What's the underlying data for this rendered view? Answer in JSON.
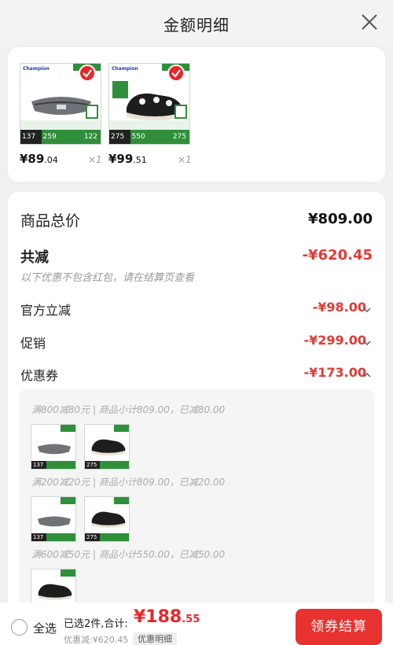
{
  "header": {
    "title": "金额明细",
    "close_icon": "close-icon"
  },
  "products": [
    {
      "price_int": "¥89",
      "price_dec": ".04",
      "qty": "×1",
      "badge": "137",
      "n1": "259",
      "n2": "122"
    },
    {
      "price_int": "¥99",
      "price_dec": ".51",
      "qty": "×1",
      "badge": "275",
      "n1": "550",
      "n2": "275"
    }
  ],
  "thumb_brand": "Champion",
  "summary": {
    "total_label": "商品总价",
    "total_value": "¥809.00",
    "discount_label": "共减",
    "discount_value": "-¥620.45",
    "note": "以下优惠不包含红包，请在结算页查看",
    "official_label": "官方立减",
    "official_value": "-¥98.00",
    "promo_label": "促销",
    "promo_value": "-¥299.00",
    "coupon_label": "优惠券",
    "coupon_value": "-¥173.00"
  },
  "coupons": [
    {
      "text": "满800减80元 | 商品小计809.00，已减80.00"
    },
    {
      "text": "满200减20元 | 商品小计809.00，已减20.00"
    },
    {
      "text": "满600减50元 | 商品小计550.00，已减50.00"
    }
  ],
  "footer": {
    "select_all": "全选",
    "selected_prefix": "已选2件,合计:",
    "total_int": "¥188",
    "total_dec": ".55",
    "discounted": "优惠减:¥620.45",
    "detail_button": "优惠明细",
    "pay_button": "领券结算"
  },
  "colors": {
    "accent": "#e8322f",
    "green": "#2f8f3a"
  }
}
